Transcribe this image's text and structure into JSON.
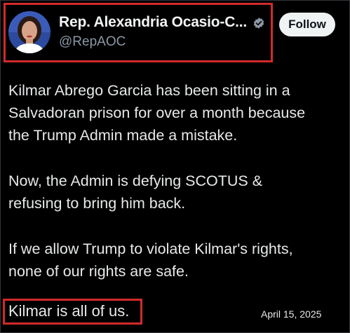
{
  "author": {
    "display_name": "Rep. Alexandria Ocasio-C...",
    "handle": "@RepAOC",
    "verified_icon": "verified-badge-icon",
    "avatar_icon": "avatar"
  },
  "follow_button": {
    "label": "Follow"
  },
  "tweet": {
    "lines": [
      "Kilmar Abrego Garcia has been sitting in a",
      "Salvadoran prison for over a month because",
      "the Trump Admin made a mistake.",
      "Now, the Admin is defying SCOTUS &",
      "refusing to bring him back.",
      "If we allow Trump to violate Kilmar's rights,",
      "none of our rights are safe.",
      "Kilmar is all of us."
    ],
    "date": "April 15, 2025"
  },
  "colors": {
    "background": "#000000",
    "text": "#e7e9ea",
    "secondary_text": "#8b98a5",
    "highlight_box": "#d12a2a",
    "follow_bg": "#eff3f4",
    "verified": "#8b98a5"
  }
}
